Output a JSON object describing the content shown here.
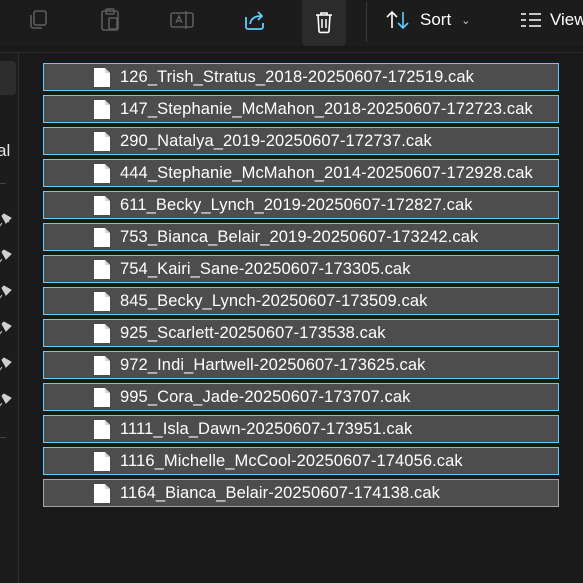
{
  "toolbar": {
    "buttons": [
      {
        "name": "copy-icon"
      },
      {
        "name": "paste-icon"
      },
      {
        "name": "rename-icon"
      },
      {
        "name": "share-icon"
      },
      {
        "name": "delete-icon"
      }
    ],
    "sort_label": "Sort",
    "view_label": "View"
  },
  "nav": {
    "partial_label": "al"
  },
  "files": [
    {
      "name": "126_Trish_Stratus_2018-20250607-172519.cak"
    },
    {
      "name": "147_Stephanie_McMahon_2018-20250607-172723.cak"
    },
    {
      "name": "290_Natalya_2019-20250607-172737.cak"
    },
    {
      "name": "444_Stephanie_McMahon_2014-20250607-172928.cak"
    },
    {
      "name": "611_Becky_Lynch_2019-20250607-172827.cak"
    },
    {
      "name": "753_Bianca_Belair_2019-20250607-173242.cak"
    },
    {
      "name": "754_Kairi_Sane-20250607-173305.cak"
    },
    {
      "name": "845_Becky_Lynch-20250607-173509.cak"
    },
    {
      "name": "925_Scarlett-20250607-173538.cak"
    },
    {
      "name": "972_Indi_Hartwell-20250607-173625.cak"
    },
    {
      "name": "995_Cora_Jade-20250607-173707.cak"
    },
    {
      "name": "1111_Isla_Dawn-20250607-173951.cak"
    },
    {
      "name": "1116_Michelle_McCool-20250607-174056.cak"
    },
    {
      "name": "1164_Bianca_Belair-20250607-174138.cak"
    }
  ],
  "colors": {
    "selection_fill": "#4d4d4d",
    "selection_border": "#60cdff",
    "share_accent": "#60cdff",
    "background": "#191919"
  }
}
